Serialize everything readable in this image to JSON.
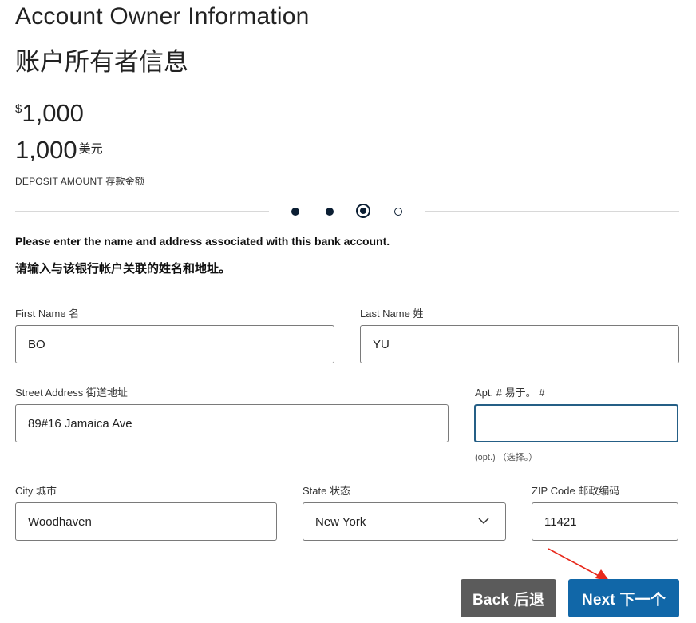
{
  "header": {
    "title": "Account Owner Information",
    "title_cn": "账户所有者信息"
  },
  "amount": {
    "currency_symbol": "$",
    "value": "1,000",
    "value_cn": "1,000",
    "unit_cn": "美元",
    "label": "DEPOSIT AMOUNT 存款金额"
  },
  "progress": {
    "total_steps": 4,
    "current_step": 3
  },
  "instructions": {
    "text": "Please enter the name and address associated with this bank account.",
    "text_cn": "请输入与该银行帐户关联的姓名和地址。"
  },
  "form": {
    "first_name": {
      "label": "First Name 名",
      "value": "BO"
    },
    "last_name": {
      "label": "Last Name 姓",
      "value": "YU"
    },
    "street": {
      "label": "Street Address 街道地址",
      "value": "89#16 Jamaica Ave"
    },
    "apt": {
      "label": "Apt. # 易于。 #",
      "value": "",
      "hint": "(opt.) （选择。）"
    },
    "city": {
      "label": "City 城市",
      "value": "Woodhaven"
    },
    "state": {
      "label": "State 状态",
      "value": "New York"
    },
    "zip": {
      "label": "ZIP Code 邮政编码",
      "value": "11421"
    }
  },
  "buttons": {
    "back_label": "Back 后退",
    "next_label": "Next 下一个"
  },
  "annotation": {
    "arrow_color": "#e8291c"
  }
}
